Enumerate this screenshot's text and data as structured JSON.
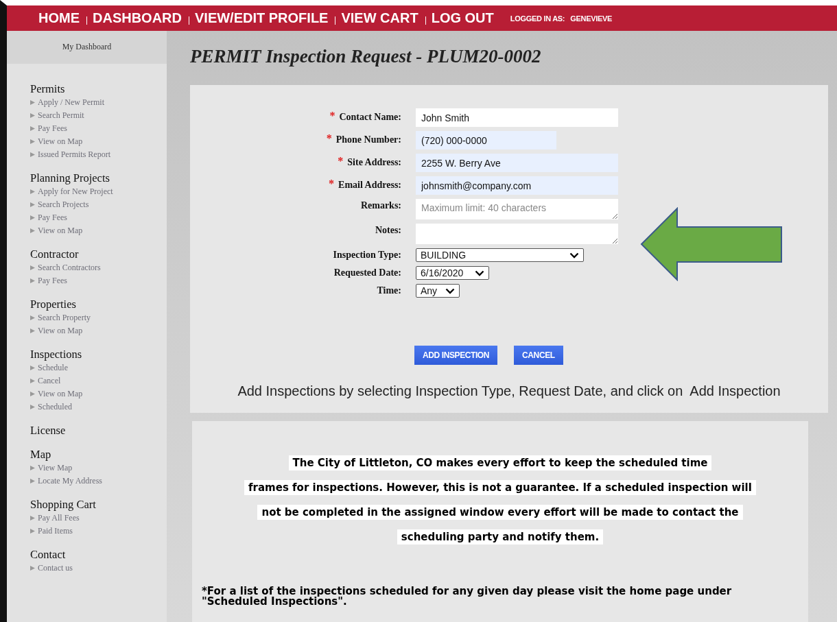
{
  "nav": {
    "links": [
      {
        "label": "HOME"
      },
      {
        "label": "DASHBOARD"
      },
      {
        "label": "VIEW/EDIT PROFILE"
      },
      {
        "label": "VIEW CART"
      },
      {
        "label": "LOG OUT"
      }
    ],
    "user_label": "LOGGED IN AS:",
    "user_name": "GENEVIEVE"
  },
  "sidebar": {
    "dashboard": "My Dashboard",
    "sections": [
      {
        "title": "Permits",
        "items": [
          "Apply / New Permit",
          "Search Permit",
          "Pay Fees",
          "View on Map",
          "Issued Permits Report"
        ]
      },
      {
        "title": "Planning Projects",
        "items": [
          "Apply for New Project",
          "Search Projects",
          "Pay Fees",
          "View on Map"
        ]
      },
      {
        "title": "Contractor",
        "items": [
          "Search Contractors",
          "Pay Fees"
        ]
      },
      {
        "title": "Properties",
        "items": [
          "Search Property",
          "View on Map"
        ]
      },
      {
        "title": "Inspections",
        "items": [
          "Schedule",
          "Cancel",
          "View on Map",
          "Scheduled"
        ]
      },
      {
        "title": "License"
      },
      {
        "title": "Map",
        "items": [
          "View Map",
          "Locate My Address"
        ]
      },
      {
        "title": "Shopping Cart",
        "items": [
          "Pay All Fees",
          "Paid Items"
        ]
      },
      {
        "title": "Contact",
        "items": [
          "Contact us"
        ]
      }
    ]
  },
  "page_title": "PERMIT Inspection Request - PLUM20-0002",
  "form": {
    "fields": [
      {
        "kind": "text",
        "label": "Contact Name:",
        "required_mark": "*",
        "autofilled": false,
        "value": "John Smith"
      },
      {
        "kind": "text",
        "label": "Phone Number:",
        "required_mark": "*",
        "autofilled": true,
        "value": "(720) 000-0000"
      },
      {
        "kind": "text",
        "label": "Site Address:",
        "required_mark": "*",
        "autofilled": true,
        "value": "2255 W. Berry Ave"
      },
      {
        "kind": "text",
        "label": "Email Address:",
        "required_mark": "*",
        "autofilled": true,
        "value": "johnsmith@company.com"
      },
      {
        "kind": "textarea",
        "label": "Remarks:",
        "placeholder": "Maximum limit: 40 characters"
      },
      {
        "kind": "textarea",
        "label": "Notes:"
      },
      {
        "kind": "select",
        "label": "Inspection Type:",
        "value": "BUILDING"
      },
      {
        "kind": "select",
        "label": "Requested Date:",
        "value": "6/16/2020"
      },
      {
        "kind": "select",
        "label": "Time:",
        "value": "Any"
      }
    ],
    "buttons": [
      "ADD INSPECTION",
      "CANCEL"
    ],
    "hint": "Add Inspections by selecting Inspection Type, Request Date, and click on  Add Inspection"
  },
  "notice": {
    "lines": [
      "The City of Littleton, CO makes every effort to keep the scheduled time",
      "frames for inspections. However, this is not a guarantee. If a scheduled inspection will",
      "not be completed in the assigned window every effort will be made to contact the",
      "scheduling party and notify them."
    ],
    "footnote": "*For a list of the inspections scheduled for any given day please visit the home page under \"Scheduled Inspections\"."
  }
}
